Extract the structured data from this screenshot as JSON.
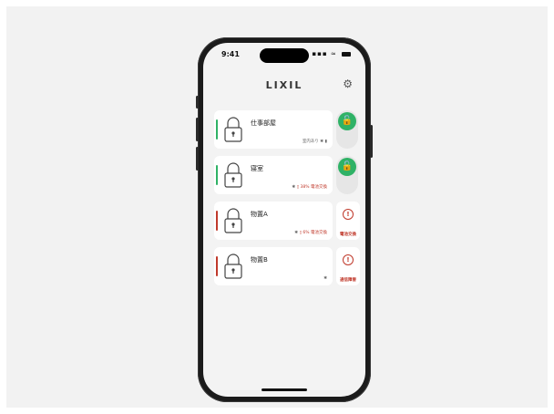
{
  "status": {
    "time": "9:41",
    "signal": "▪▪▪"
  },
  "header": {
    "logo": "LIXIL"
  },
  "locks": [
    {
      "name": "仕事部屋",
      "meta": "室内あり",
      "accent": "#2fb266",
      "side": "toggle"
    },
    {
      "name": "寝室",
      "meta_pct": "38%",
      "meta_warn": "電池交換",
      "accent": "#2fb266",
      "side": "toggle"
    },
    {
      "name": "物置A",
      "meta_pct": "6%",
      "meta_warn": "電池交換",
      "accent": "#c0392b",
      "side": "alert",
      "alert": "電池交換"
    },
    {
      "name": "物置B",
      "accent": "#c0392b",
      "side": "alert",
      "alert": "通信障害"
    }
  ],
  "colors": {
    "ok": "#2fb266",
    "error": "#c0392b"
  }
}
